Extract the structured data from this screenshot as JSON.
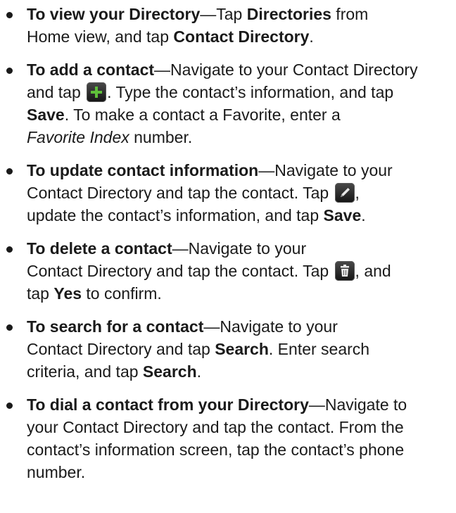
{
  "items": [
    {
      "title": "To view your Directory",
      "dash": "—",
      "l1_a": "Tap ",
      "l1_b": "Directories",
      "l1_c": " from",
      "l2_a": "Home view, and tap ",
      "l2_b": "Contact Directory",
      "l2_c": "."
    },
    {
      "title": "To add a contact",
      "dash": "—",
      "l1_a": "Navigate to your Contact Directory",
      "l2_a": "and tap ",
      "l2_b": ". Type the contact’s information, and tap",
      "l3_a": "Save",
      "l3_b": ". To make a contact a Favorite, enter a",
      "l4_a": "Favorite Index",
      "l4_b": " number."
    },
    {
      "title": "To update contact information",
      "dash": "—",
      "l1_a": "Navigate to your",
      "l2_a": "Contact Directory and tap the contact. Tap ",
      "l2_b": ",",
      "l3_a": "update the contact’s information, and tap ",
      "l3_b": "Save",
      "l3_c": "."
    },
    {
      "title": "To delete a contact",
      "dash": "—",
      "l1_a": "Navigate to your",
      "l2_a": "Contact Directory and tap the contact. Tap ",
      "l2_b": ", and",
      "l3_a": "tap ",
      "l3_b": "Yes",
      "l3_c": " to confirm."
    },
    {
      "title": "To search for a contact",
      "dash": "—",
      "l1_a": "Navigate to your",
      "l2_a": "Contact Directory and tap ",
      "l2_b": "Search",
      "l2_c": ". Enter search",
      "l3_a": "criteria, and tap ",
      "l3_b": "Search",
      "l3_c": "."
    },
    {
      "title": "To dial a contact from your Directory",
      "dash": "—",
      "l1_a": "Navigate to",
      "l2_a": "your Contact Directory and tap the contact. From the",
      "l3_a": "contact’s information screen, tap the contact’s phone",
      "l4_a": "number."
    }
  ],
  "icons": {
    "add": "add-icon",
    "edit": "edit-icon",
    "delete": "trash-icon",
    "add_color": "#5fc03a",
    "edit_color": "#e8e8e8",
    "delete_color": "#e8e8e8"
  }
}
